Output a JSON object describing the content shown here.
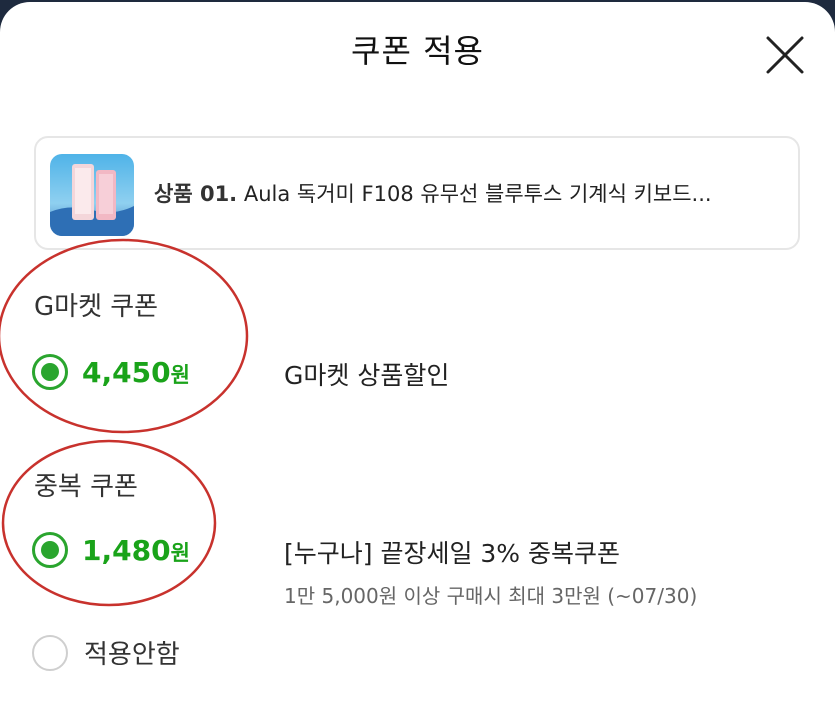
{
  "header": {
    "title": "쿠폰 적용"
  },
  "product": {
    "code": "상품 01.",
    "name": "Aula 독거미 F108 유무선 블루투스 기계식 키보드..."
  },
  "coupons": {
    "gmarket": {
      "section_title": "G마켓 쿠폰",
      "amount": "4,450",
      "unit": "원",
      "name": "G마켓 상품할인",
      "selected": true
    },
    "double": {
      "section_title": "중복 쿠폰",
      "amount": "1,480",
      "unit": "원",
      "name": "[누구나] 끝장세일 3% 중복쿠폰",
      "condition": "1만 5,000원 이상 구매시 최대 3만원 (~07/30)",
      "selected": true
    },
    "none": {
      "label": "적용안함",
      "selected": false
    }
  },
  "colors": {
    "accent_green": "#2aa52e",
    "amount_green": "#1aa31a",
    "annotation_red": "#c8322d"
  }
}
